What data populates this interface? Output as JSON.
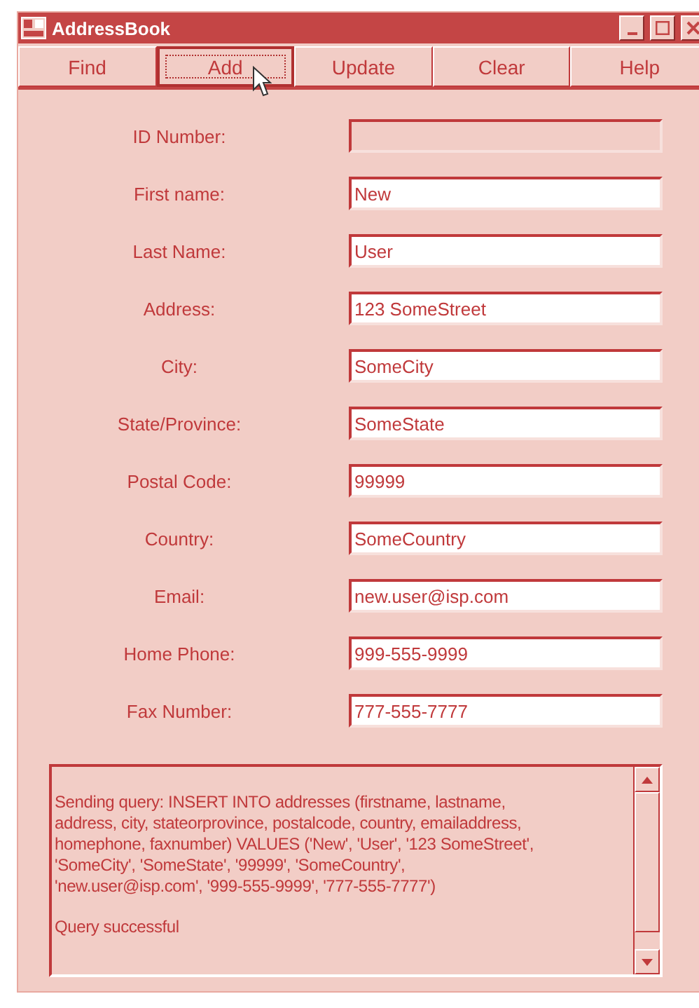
{
  "window": {
    "title": "AddressBook"
  },
  "toolbar": [
    {
      "label": "Find",
      "focused": false
    },
    {
      "label": "Add",
      "focused": true
    },
    {
      "label": "Update",
      "focused": false
    },
    {
      "label": "Clear",
      "focused": false
    },
    {
      "label": "Help",
      "focused": false
    }
  ],
  "fields": [
    {
      "label": "ID Number:",
      "disabled": true
    },
    {
      "label": "First name:",
      "value": "New",
      "disabled": false
    },
    {
      "label": "Last Name:",
      "value": "User",
      "disabled": false
    },
    {
      "label": "Address:",
      "value": "123 SomeStreet",
      "disabled": false
    },
    {
      "label": "City:",
      "value": "SomeCity",
      "disabled": false
    },
    {
      "label": "State/Province:",
      "value": "SomeState",
      "disabled": false
    },
    {
      "label": "Postal Code:",
      "value": "99999",
      "disabled": false
    },
    {
      "label": "Country:",
      "value": "SomeCountry",
      "disabled": false
    },
    {
      "label": "Email:",
      "value": "new.user@isp.com",
      "disabled": false
    },
    {
      "label": "Home Phone:",
      "value": "999-555-9999",
      "disabled": false
    },
    {
      "label": "Fax Number:",
      "value": "777-555-7777",
      "disabled": false
    }
  ],
  "log": [
    "Sending query: INSERT INTO addresses (firstname, lastname,\naddress, city, stateorprovince, postalcode, country, emailaddress,\nhomephone, faxnumber) VALUES ('New', 'User', '123 SomeStreet',\n'SomeCity', 'SomeState', '99999', 'SomeCountry',\n'new.user@isp.com', '999-555-9999', '777-555-7777')",
    "Query successful"
  ]
}
